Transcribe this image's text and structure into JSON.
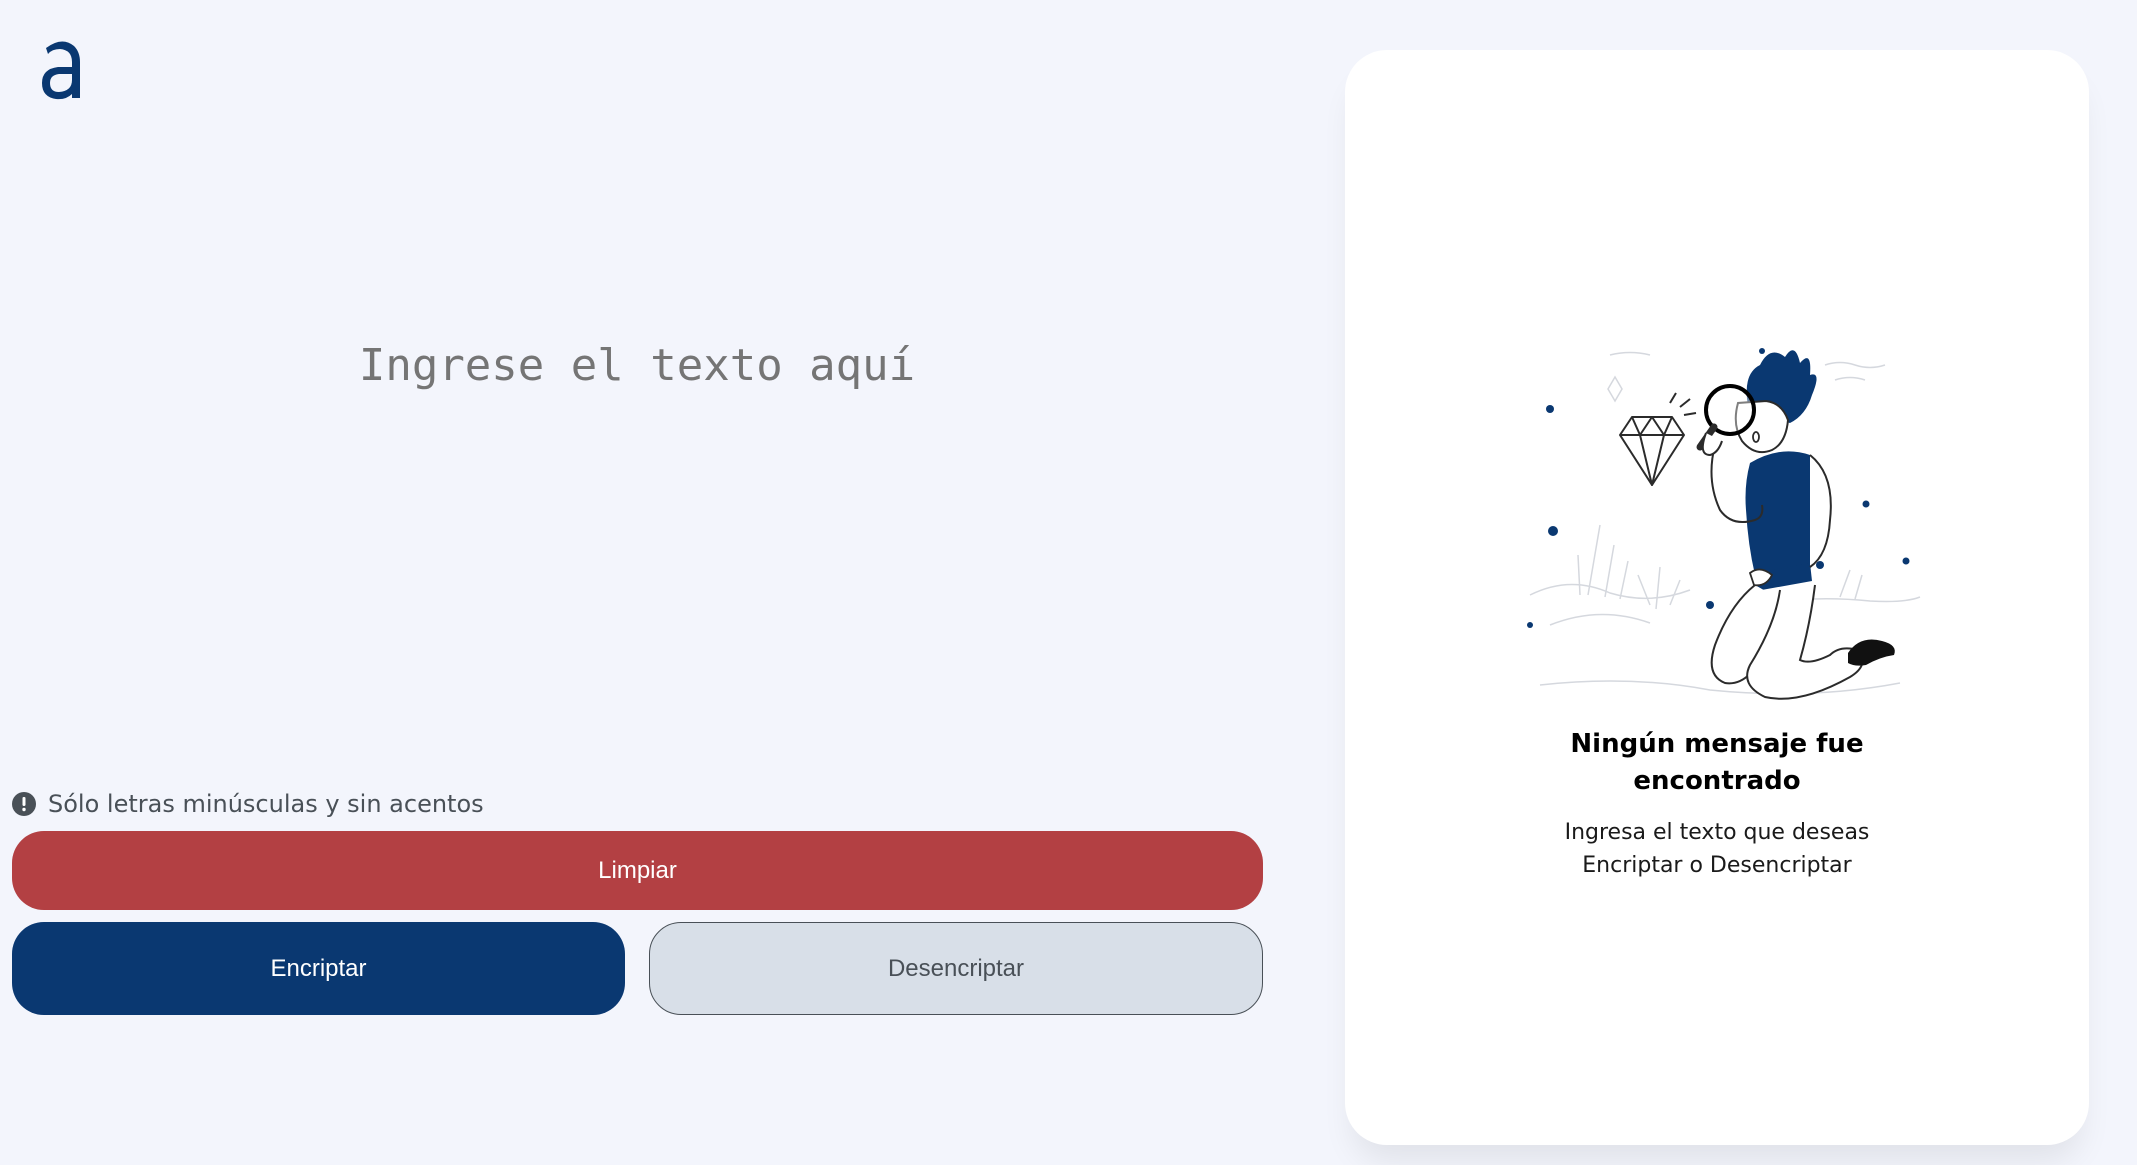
{
  "brand": {
    "logo_icon": "alura-a-logo",
    "accent_color": "#0A3871"
  },
  "input": {
    "placeholder": "Ingrese el texto aquí",
    "value": ""
  },
  "hint": {
    "icon": "exclamation-circle-icon",
    "text": "Sólo letras minúsculas y sin acentos"
  },
  "buttons": {
    "clear_label": "Limpiar",
    "encrypt_label": "Encriptar",
    "decrypt_label": "Desencriptar",
    "clear_color": "#B34043",
    "encrypt_color": "#0A3871",
    "decrypt_color": "#D8DFE8"
  },
  "output": {
    "illustration_icon": "person-with-magnifier-illustration",
    "title_line1": "Ningún mensaje fue",
    "title_line2": "encontrado",
    "text_line1": "Ingresa el texto que deseas",
    "text_line2": "Encriptar o Desencriptar"
  }
}
